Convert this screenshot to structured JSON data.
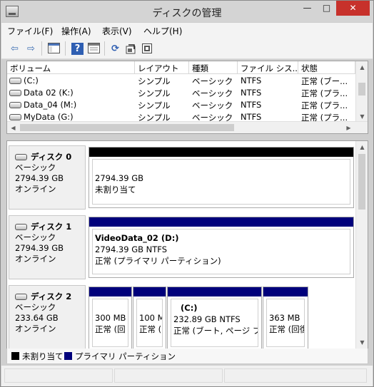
{
  "window": {
    "title": "ディスクの管理",
    "controls": {
      "minimize": "—",
      "maximize": "□",
      "close": "✕"
    }
  },
  "menu": [
    "ファイル(F)",
    "操作(A)",
    "表示(V)",
    "ヘルプ(H)"
  ],
  "toolbar": {
    "icons": [
      "back-arrow-icon",
      "forward-arrow-icon",
      "console-tree-icon",
      "help-icon",
      "properties-icon",
      "refresh-icon",
      "export-icon",
      "settings-icon"
    ],
    "glyphs": {
      "back": "⇦",
      "forward": "⇨",
      "help": "?",
      "refresh": "⟳"
    }
  },
  "volume_list": {
    "columns": [
      "ボリューム",
      "レイアウト",
      "種類",
      "ファイル シス...",
      "状態"
    ],
    "rows": [
      {
        "volume": "(C:)",
        "layout": "シンプル",
        "type": "ベーシック",
        "fs": "NTFS",
        "status": "正常 (ブー..."
      },
      {
        "volume": "Data 02 (K:)",
        "layout": "シンプル",
        "type": "ベーシック",
        "fs": "NTFS",
        "status": "正常 (プラ..."
      },
      {
        "volume": "Data_04 (M:)",
        "layout": "シンプル",
        "type": "ベーシック",
        "fs": "NTFS",
        "status": "正常 (プラ..."
      },
      {
        "volume": "MyData (G:)",
        "layout": "シンプル",
        "type": "ベーシック",
        "fs": "NTFS",
        "status": "正常 (プラ..."
      }
    ]
  },
  "disks": [
    {
      "name": "ディスク 0",
      "type": "ベーシック",
      "size": "2794.39 GB",
      "state": "オンライン",
      "partitions": [
        {
          "line1": "",
          "line2": "2794.39 GB",
          "line3": "未割り当て",
          "kind": "unallocated"
        }
      ]
    },
    {
      "name": "ディスク 1",
      "type": "ベーシック",
      "size": "2794.39 GB",
      "state": "オンライン",
      "partitions": [
        {
          "line1": "VideoData_02  (D:)",
          "line2": "2794.39 GB NTFS",
          "line3": "正常 (プライマリ パーティション)",
          "kind": "primary"
        }
      ]
    },
    {
      "name": "ディスク 2",
      "type": "ベーシック",
      "size": "233.64 GB",
      "state": "オンライン",
      "partitions": [
        {
          "line1": "",
          "line2": "300 MB",
          "line3": "正常 (回",
          "kind": "primary"
        },
        {
          "line1": "",
          "line2": "100 M",
          "line3": "正常 (",
          "kind": "primary"
        },
        {
          "line1": "(C:)",
          "line2": "232.89 GB NTFS",
          "line3": "正常 (ブート, ページ ファ",
          "kind": "primary"
        },
        {
          "line1": "",
          "line2": "363 MB",
          "line3": "正常 (回復",
          "kind": "primary"
        }
      ]
    }
  ],
  "legend": [
    {
      "label": "未割り当て",
      "color": "#000000"
    },
    {
      "label": "プライマリ パーティション",
      "color": "#00007b"
    }
  ]
}
